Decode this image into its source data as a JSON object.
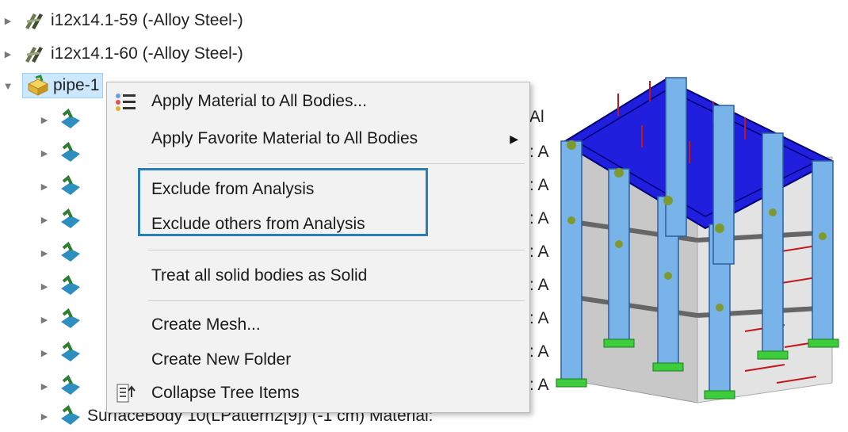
{
  "tree": {
    "rows": [
      {
        "label": "i12x14.1-59 (-Alloy Steel-)"
      },
      {
        "label": "i12x14.1-60 (-Alloy Steel-)"
      },
      {
        "label": "pipe-1"
      },
      {
        "label": "SurfaceBody 10(LPattern2[9]) (-1 cm) Material:"
      }
    ]
  },
  "context_menu": {
    "items": [
      {
        "label": "Apply Material to All Bodies..."
      },
      {
        "label": "Apply Favorite Material to All Bodies"
      },
      {
        "label": "Exclude from Analysis"
      },
      {
        "label": "Exclude others from Analysis"
      },
      {
        "label": "Treat all solid bodies as Solid"
      },
      {
        "label": "Create Mesh..."
      },
      {
        "label": "Create New Folder"
      },
      {
        "label": "Collapse Tree Items"
      }
    ],
    "submenu_indicator": "▶"
  },
  "clipped_text": {
    "right_fragment_1": "Al",
    "right_fragment_2": ": A"
  },
  "colors": {
    "selection_bg": "#cce8ff",
    "highlight_border": "#2b7eb5",
    "model_top_plate": "#1f1fdd",
    "column_blue": "#78b4ea"
  }
}
